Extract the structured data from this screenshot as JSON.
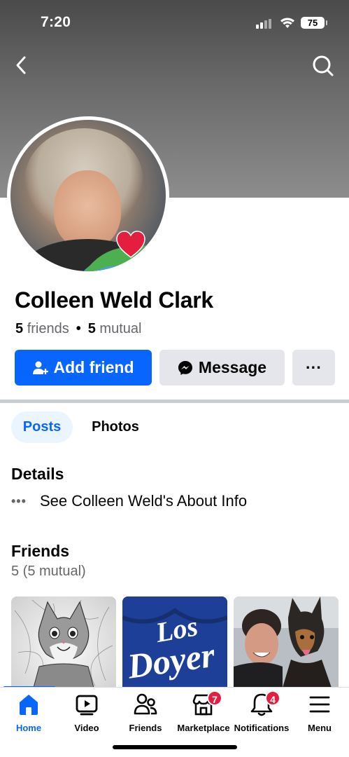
{
  "status_bar": {
    "time": "7:20",
    "battery": "75"
  },
  "profile": {
    "name": "Colleen Weld Clark",
    "friends_count": "5",
    "friends_label": "friends",
    "mutual_count": "5",
    "mutual_label": "mutual"
  },
  "actions": {
    "add_friend": "Add friend",
    "message": "Message",
    "more": "···"
  },
  "tabs": [
    {
      "label": "Posts",
      "active": true
    },
    {
      "label": "Photos",
      "active": false
    }
  ],
  "details": {
    "title": "Details",
    "about_link": "See Colleen Weld's About Info"
  },
  "friends": {
    "title": "Friends",
    "subtitle": "5 (5 mutual)"
  },
  "thumb_text": {
    "dodgers": "Los Doyers"
  },
  "bottom_nav": [
    {
      "label": "Home",
      "icon": "home-icon",
      "active": true
    },
    {
      "label": "Video",
      "icon": "video-icon"
    },
    {
      "label": "Friends",
      "icon": "friends-icon"
    },
    {
      "label": "Marketplace",
      "icon": "marketplace-icon",
      "badge": "7"
    },
    {
      "label": "Notifications",
      "icon": "bell-icon",
      "badge": "4"
    },
    {
      "label": "Menu",
      "icon": "menu-icon"
    }
  ],
  "colors": {
    "accent": "#0866ff",
    "badge": "#e41e3f",
    "secondary_button": "#e4e6eb"
  }
}
